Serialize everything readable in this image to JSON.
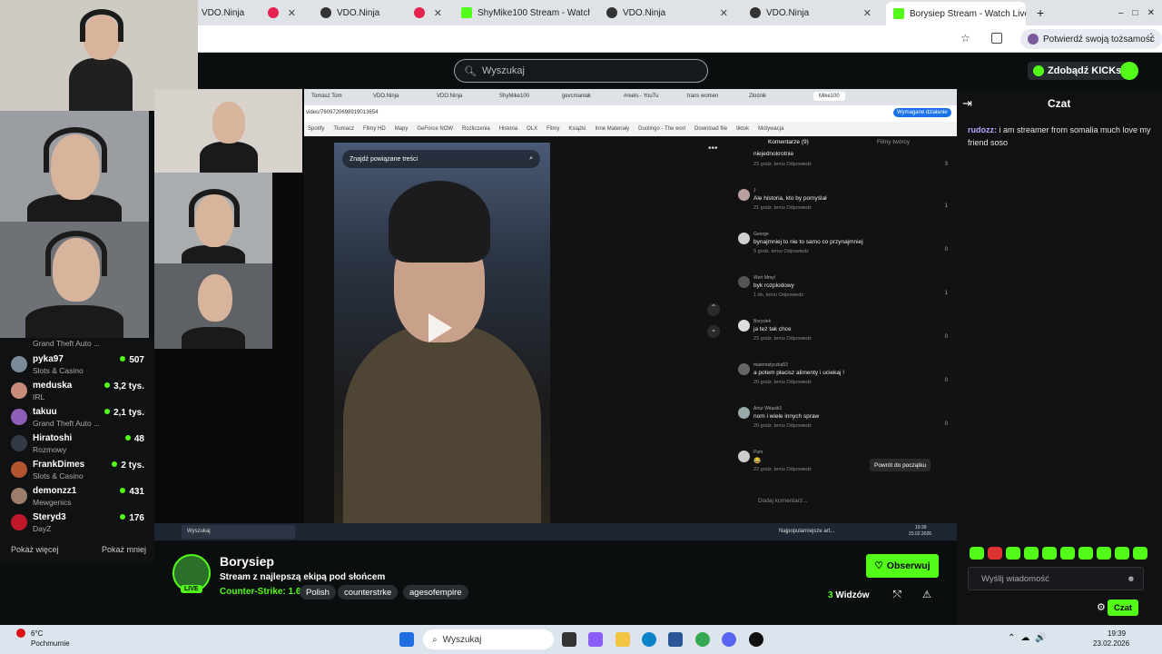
{
  "browser": {
    "tabs": [
      {
        "label": "VDO.Ninja",
        "active": false
      },
      {
        "label": "VDO.Ninja",
        "active": false
      },
      {
        "label": "ShyMike100 Stream - Watch L",
        "active": false
      },
      {
        "label": "VDO.Ninja",
        "active": false
      },
      {
        "label": "VDO.Ninja",
        "active": false
      },
      {
        "label": "Borysiep Stream - Watch Live o",
        "active": true
      }
    ],
    "new_tab": "+",
    "profile_prompt": "Potwierdź swoją tożsamość"
  },
  "kick_header": {
    "search_placeholder": "Wyszukaj",
    "kicks_button": "Zdobądź KICKs"
  },
  "sidebar": {
    "first_category": "Grand Theft Auto ...",
    "channels": [
      {
        "name": "pyka97",
        "category": "Slots & Casino",
        "viewers": "507",
        "color": "#7a8a96"
      },
      {
        "name": "meduska",
        "category": "IRL",
        "viewers": "3,2 tys.",
        "color": "#c98a7a"
      },
      {
        "name": "takuu",
        "category": "Grand Theft Auto ...",
        "viewers": "2,1 tys.",
        "color": "#8e5fb8"
      },
      {
        "name": "Hiratoshi",
        "category": "Rozmowy",
        "viewers": "48",
        "color": "#333a44"
      },
      {
        "name": "FrankDimes",
        "category": "Slots & Casino",
        "viewers": "2 tys.",
        "color": "#b2542e"
      },
      {
        "name": "demonzz1",
        "category": "Mewgenics",
        "viewers": "431",
        "color": "#9a7d6a"
      },
      {
        "name": "Steryd3",
        "category": "DayZ",
        "viewers": "176",
        "color": "#c0182b"
      }
    ],
    "show_more": "Pokaż więcej",
    "show_less": "Pokaż mniej"
  },
  "video": {
    "inner_tabs": [
      "Tomasz Tom",
      "VDO.Ninja",
      "VDO.Ninja",
      "ShyMike100",
      "gevcmaniak",
      "#reels - YouTu",
      "trans women",
      "Złośnik",
      "Mike100"
    ],
    "inner_url": "video/7609720698919013654",
    "action_required": "Wymagane działanie",
    "bookmarks": [
      "Spotify",
      "Tłumacz",
      "Filmy HD",
      "Mapy",
      "GeForce NOW",
      "Rozliczenia",
      "Historia",
      "OLX",
      "Filmy",
      "Książki",
      "Inne Materiały",
      "Duolingo - The worl",
      "Download file",
      "tiktok",
      "Motywacja"
    ],
    "related_search": "Znajdź powiązane treści",
    "comments_tab": "Komentarze (9)",
    "creator_tab": "Filmy twórcy",
    "comments": [
      {
        "user": "",
        "text": "niejednokrotnie",
        "meta": "23 godz. temu   Odpowiedz",
        "likes": "3",
        "color": "#999"
      },
      {
        "user": "J",
        "text": "Ale historia, kto by pomyślał",
        "meta": "21 godz. temu   Odpowiedz",
        "likes": "1",
        "color": "#b9a0a0"
      },
      {
        "user": "George",
        "text": "bynajmniej to nie to samo co przynajmniej",
        "meta": "5 godz. temu   Odpowiedz",
        "likes": "0",
        "color": "#d0d0d0"
      },
      {
        "user": "Wert Mmyl",
        "text": "byk rozplodowy",
        "meta": "1 dn. temu   Odpowiedz",
        "likes": "1",
        "color": "#555"
      },
      {
        "user": "Borysiek",
        "text": "ja też tak chce",
        "meta": "23 godz. temu   Odpowiedz",
        "likes": "0",
        "color": "#ddd"
      },
      {
        "user": "matematyczka53",
        "text": "a potem płacisz alimenty i uciekaj !",
        "meta": "20 godz. temu   Odpowiedz",
        "likes": "0",
        "color": "#666"
      },
      {
        "user": "Artur Witasik3",
        "text": "nom i wiele innych spraw",
        "meta": "20 godz. temu   Odpowiedz",
        "likes": "0",
        "color": "#9aa"
      },
      {
        "user": "Pam",
        "text": "😂",
        "meta": "22 godz. temu   Odpowiedz",
        "likes": "",
        "color": "#ccc"
      }
    ],
    "back_to_top": "Powrót do początku",
    "add_comment": "Dodaj komentarz...",
    "inner_taskbar_search": "Wyszukaj",
    "inner_taskbar_app": "Najpopularniejsze art...",
    "inner_time": "19:39",
    "inner_date": "23.02.2026"
  },
  "chat": {
    "title": "Czat",
    "messages": [
      {
        "user": "rudozz:",
        "text": " i am streamer from somalia much love my friend soso"
      }
    ],
    "input_placeholder": "Wyślij wiadomość",
    "send_button": "Czat"
  },
  "stream": {
    "channel": "Borysiep",
    "live_badge": "LIVE",
    "title": "Stream z najlepszą ekipą pod słońcem",
    "category": "Counter-Strike: 1.6",
    "tags": [
      "Polish",
      "counterstrke",
      "agesofempire"
    ],
    "follow_button": "Obserwuj",
    "viewers_count": "3",
    "viewers_label": "Widzów"
  },
  "taskbar": {
    "weather_temp": "6°C",
    "weather_desc": "Pochmurnie",
    "search": "Wyszukaj",
    "time": "19:39",
    "date": "23.02.2026"
  },
  "colors": {
    "accent": "#53fc18",
    "background": "#0b0e0f",
    "chat_user": "#b9a7ff"
  }
}
